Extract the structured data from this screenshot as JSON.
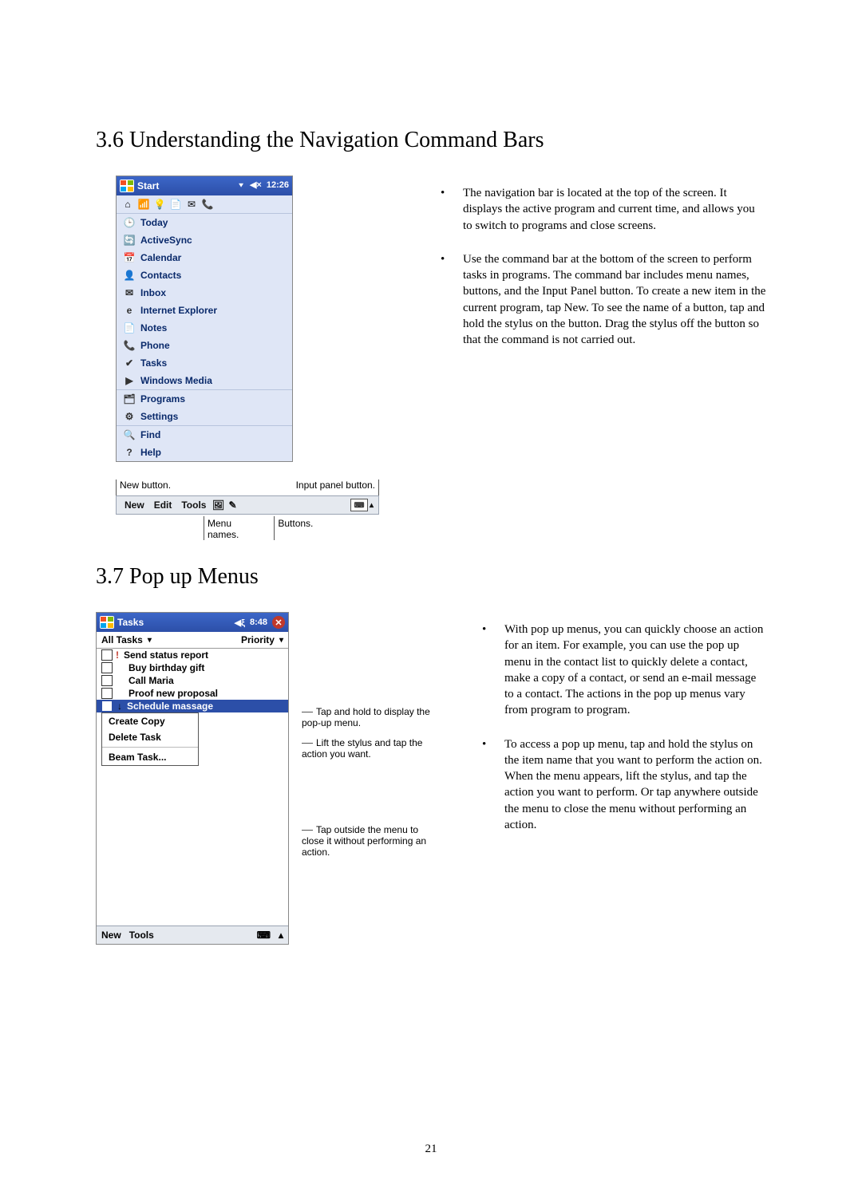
{
  "section36": {
    "heading": "3.6 Understanding the Navigation Command Bars",
    "bullets": [
      "The navigation bar is located at the top of the screen. It displays the active program and current time, and allows you to switch to programs and close screens.",
      "Use the command bar at the bottom of the screen to perform tasks in programs. The command bar includes menu names, buttons, and the Input Panel button. To create a new item in the current program, tap New. To see the name of a button, tap and hold the stylus on the button. Drag the stylus off the button so that the command is not carried out."
    ]
  },
  "startMenu": {
    "navTitle": "Start",
    "navTime": "12:26",
    "trayIcons": [
      "⌂",
      "📶",
      "💡",
      "📄",
      "✉",
      "📞"
    ],
    "groups": [
      [
        {
          "icon": "🕒",
          "cls": "ic-today",
          "label": "Today"
        },
        {
          "icon": "🔄",
          "cls": "ic-sync",
          "label": "ActiveSync"
        },
        {
          "icon": "📅",
          "cls": "ic-cal",
          "label": "Calendar"
        },
        {
          "icon": "👤",
          "cls": "ic-contacts",
          "label": "Contacts"
        },
        {
          "icon": "✉",
          "cls": "ic-inbox",
          "label": "Inbox"
        },
        {
          "icon": "e",
          "cls": "ic-ie",
          "label": "Internet Explorer"
        },
        {
          "icon": "📄",
          "cls": "ic-notes",
          "label": "Notes"
        },
        {
          "icon": "📞",
          "cls": "ic-phone",
          "label": "Phone"
        },
        {
          "icon": "✔",
          "cls": "ic-tasks",
          "label": "Tasks"
        },
        {
          "icon": "▶",
          "cls": "ic-media",
          "label": "Windows Media"
        }
      ],
      [
        {
          "icon": "🗂",
          "cls": "ic-programs",
          "label": "Programs"
        },
        {
          "icon": "⚙",
          "cls": "ic-settings",
          "label": "Settings"
        }
      ],
      [
        {
          "icon": "🔍",
          "cls": "ic-find",
          "label": "Find"
        },
        {
          "icon": "?",
          "cls": "ic-help",
          "label": "Help"
        }
      ]
    ]
  },
  "commandBar": {
    "calloutNew": "New button.",
    "calloutInput": "Input panel button.",
    "calloutMenuNames": "Menu\nnames.",
    "calloutButtons": "Buttons.",
    "items": {
      "new": "New",
      "edit": "Edit",
      "tools": "Tools"
    }
  },
  "section37": {
    "heading": "3.7  Pop up Menus",
    "bullets": [
      "With pop up menus, you can quickly choose an action for an item. For example, you can use the pop up menu in the contact list to quickly delete a contact, make a copy of a contact, or send an e-mail message to a contact. The actions in the pop up menus vary from program to program.",
      "To access a pop up menu, tap and hold the stylus on the item name that you want to perform the action on. When the menu appears, lift the stylus, and tap the action you want to perform. Or tap anywhere outside the menu to close the menu without performing an action."
    ]
  },
  "tasksFig": {
    "navTitle": "Tasks",
    "navTime": "8:48",
    "leftTab": "All Tasks",
    "rightTab": "Priority",
    "tasks": [
      {
        "pri": "!",
        "label": "Send status report"
      },
      {
        "pri": "",
        "label": "Buy birthday gift"
      },
      {
        "pri": "",
        "label": "Call Maria"
      },
      {
        "pri": "",
        "label": "Proof new proposal"
      },
      {
        "pri": "↓",
        "label": "Schedule massage",
        "selected": true
      }
    ],
    "popup": [
      "Create Copy",
      "Delete Task",
      "—",
      "Beam Task..."
    ],
    "cmd": {
      "new": "New",
      "tools": "Tools"
    },
    "ann1": "Tap and hold to display the pop-up menu.",
    "ann2": "Lift the stylus and tap the action you want.",
    "ann3": "Tap outside the menu to close it without performing an action."
  },
  "pageNumber": "21"
}
